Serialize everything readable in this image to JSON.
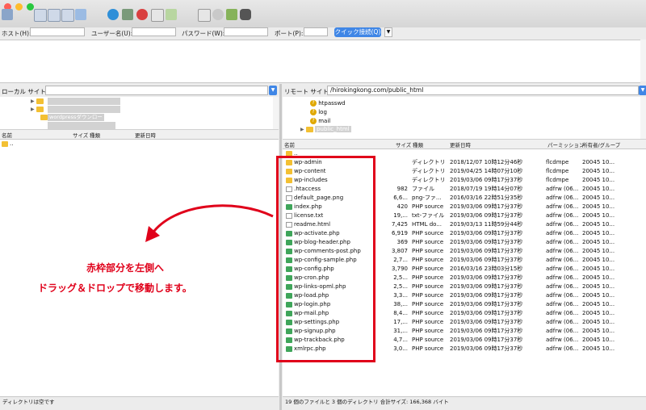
{
  "colors": {
    "accent": "#3f86e6",
    "annotation_red": "#e0001a",
    "folder": "#f3c033",
    "php": "#3fa55a"
  },
  "quickconnect": {
    "host_label": "ホスト(H):",
    "user_label": "ユーザー名(U):",
    "password_label": "パスワード(W):",
    "port_label": "ポート(P):",
    "connect_button": "クイック接続(Q)"
  },
  "local": {
    "site_label": "ローカル サイト:",
    "tree_highlight": "wordpressダウンロード",
    "columns": {
      "name": "名前",
      "size": "サイズ",
      "type": "種類",
      "modified": "更新日時"
    },
    "parent_row": "..",
    "status": "ディレクトリは空です"
  },
  "remote": {
    "site_label": "リモート サイト:",
    "path": "/hirokingkong.com/public_html",
    "tree": [
      "htpasswd",
      "log",
      "mail",
      "public_html"
    ],
    "columns": {
      "name": "名前",
      "size": "サイズ",
      "type": "種類",
      "modified": "更新日時",
      "perm": "パーミッション",
      "owner": "所有者/グループ"
    },
    "parent_row": "..",
    "files": [
      {
        "name": "wp-admin",
        "size": "",
        "type": "ディレクトリ",
        "modified": "2018/12/07 10時12分46秒",
        "perm": "flcdmpe",
        "owner": "20045 10...",
        "icon": "folder"
      },
      {
        "name": "wp-content",
        "size": "",
        "type": "ディレクトリ",
        "modified": "2019/04/25 14時07分10秒",
        "perm": "flcdmpe",
        "owner": "20045 10...",
        "icon": "folder"
      },
      {
        "name": "wp-includes",
        "size": "",
        "type": "ディレクトリ",
        "modified": "2019/03/06 09時17分37秒",
        "perm": "flcdmpe",
        "owner": "20045 10...",
        "icon": "folder"
      },
      {
        "name": ".htaccess",
        "size": "982",
        "type": "ファイル",
        "modified": "2018/07/19 19時14分07秒",
        "perm": "adfrw (06...",
        "owner": "20045 10...",
        "icon": "file"
      },
      {
        "name": "default_page.png",
        "size": "6,6...",
        "type": "png-ファ...",
        "modified": "2016/03/16 22時51分35秒",
        "perm": "adfrw (06...",
        "owner": "20045 10...",
        "icon": "file"
      },
      {
        "name": "index.php",
        "size": "420",
        "type": "PHP source",
        "modified": "2019/03/06 09時17分37秒",
        "perm": "adfrw (06...",
        "owner": "20045 10...",
        "icon": "php"
      },
      {
        "name": "license.txt",
        "size": "19,...",
        "type": "txt-ファイル",
        "modified": "2019/03/06 09時17分37秒",
        "perm": "adfrw (06...",
        "owner": "20045 10...",
        "icon": "file"
      },
      {
        "name": "readme.html",
        "size": "7,425",
        "type": "HTML do...",
        "modified": "2019/03/13 11時59分44秒",
        "perm": "adfrw (06...",
        "owner": "20045 10...",
        "icon": "html"
      },
      {
        "name": "wp-activate.php",
        "size": "6,919",
        "type": "PHP source",
        "modified": "2019/03/06 09時17分37秒",
        "perm": "adfrw (06...",
        "owner": "20045 10...",
        "icon": "php"
      },
      {
        "name": "wp-blog-header.php",
        "size": "369",
        "type": "PHP source",
        "modified": "2019/03/06 09時17分37秒",
        "perm": "adfrw (06...",
        "owner": "20045 10...",
        "icon": "php"
      },
      {
        "name": "wp-comments-post.php",
        "size": "3,807",
        "type": "PHP source",
        "modified": "2019/03/06 09時17分37秒",
        "perm": "adfrw (06...",
        "owner": "20045 10...",
        "icon": "php"
      },
      {
        "name": "wp-config-sample.php",
        "size": "2,7...",
        "type": "PHP source",
        "modified": "2019/03/06 09時17分37秒",
        "perm": "adfrw (06...",
        "owner": "20045 10...",
        "icon": "php"
      },
      {
        "name": "wp-config.php",
        "size": "3,790",
        "type": "PHP source",
        "modified": "2016/03/16 23時03分15秒",
        "perm": "adfrw (06...",
        "owner": "20045 10...",
        "icon": "php"
      },
      {
        "name": "wp-cron.php",
        "size": "2,5...",
        "type": "PHP source",
        "modified": "2019/03/06 09時17分37秒",
        "perm": "adfrw (06...",
        "owner": "20045 10...",
        "icon": "php"
      },
      {
        "name": "wp-links-opml.php",
        "size": "2,5...",
        "type": "PHP source",
        "modified": "2019/03/06 09時17分37秒",
        "perm": "adfrw (06...",
        "owner": "20045 10...",
        "icon": "php"
      },
      {
        "name": "wp-load.php",
        "size": "3,3...",
        "type": "PHP source",
        "modified": "2019/03/06 09時17分37秒",
        "perm": "adfrw (06...",
        "owner": "20045 10...",
        "icon": "php"
      },
      {
        "name": "wp-login.php",
        "size": "38,...",
        "type": "PHP source",
        "modified": "2019/03/06 09時17分37秒",
        "perm": "adfrw (06...",
        "owner": "20045 10...",
        "icon": "php"
      },
      {
        "name": "wp-mail.php",
        "size": "8,4...",
        "type": "PHP source",
        "modified": "2019/03/06 09時17分37秒",
        "perm": "adfrw (06...",
        "owner": "20045 10...",
        "icon": "php"
      },
      {
        "name": "wp-settings.php",
        "size": "17,...",
        "type": "PHP source",
        "modified": "2019/03/06 09時17分37秒",
        "perm": "adfrw (06...",
        "owner": "20045 10...",
        "icon": "php"
      },
      {
        "name": "wp-signup.php",
        "size": "31,...",
        "type": "PHP source",
        "modified": "2019/03/06 09時17分37秒",
        "perm": "adfrw (06...",
        "owner": "20045 10...",
        "icon": "php"
      },
      {
        "name": "wp-trackback.php",
        "size": "4,7...",
        "type": "PHP source",
        "modified": "2019/03/06 09時17分37秒",
        "perm": "adfrw (06...",
        "owner": "20045 10...",
        "icon": "php"
      },
      {
        "name": "xmlrpc.php",
        "size": "3,0...",
        "type": "PHP source",
        "modified": "2019/03/06 09時17分37秒",
        "perm": "adfrw (06...",
        "owner": "20045 10...",
        "icon": "php"
      }
    ],
    "status": "19 個のファイルと 3 個のディレクトリ 合計サイズ: 166,368 バイト"
  },
  "annotation": {
    "line1": "赤枠部分を左側へ",
    "line2": "ドラッグ＆ドロップで移動します。"
  }
}
